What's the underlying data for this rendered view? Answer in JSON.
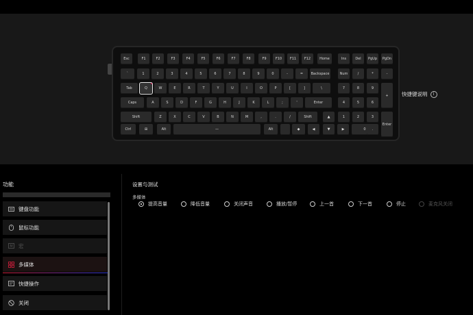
{
  "keyboard": {
    "rows": [
      [
        "Esc",
        "F1",
        "F2",
        "F3",
        "F4",
        "F5",
        "F6",
        "F7",
        "F8",
        "F9",
        "F10",
        "F11",
        "F12",
        "Home",
        "Ins",
        "Del",
        "PgUp",
        "PgDn"
      ],
      [
        "`",
        "1",
        "2",
        "3",
        "4",
        "5",
        "6",
        "7",
        "8",
        "9",
        "0",
        "-",
        "=",
        "Backspace",
        "Num",
        "/",
        "*",
        "-"
      ],
      [
        "Tab",
        "Q",
        "W",
        "E",
        "R",
        "T",
        "Y",
        "U",
        "I",
        "O",
        "P",
        "[",
        "]",
        "\\",
        "7",
        "8",
        "9",
        "+"
      ],
      [
        "Caps",
        "A",
        "S",
        "D",
        "F",
        "G",
        "H",
        "J",
        "K",
        "L",
        ";",
        "'",
        "Enter",
        "4",
        "5",
        "6"
      ],
      [
        "Shift",
        "Z",
        "X",
        "C",
        "V",
        "B",
        "N",
        "M",
        ",",
        ".",
        "/",
        "Shift",
        "▲",
        "1",
        "2",
        "3",
        "Enter"
      ],
      [
        "Ctrl",
        "⊞",
        "Alt",
        "—",
        "Alt",
        "",
        "◆",
        "◀",
        "▼",
        "▶",
        "0",
        "."
      ]
    ],
    "selected_key": "Q"
  },
  "hotkey_help": {
    "label": "快捷键说明",
    "icon": "info-icon"
  },
  "function_panel": {
    "title": "功能",
    "items": [
      {
        "label": "键盘功能",
        "icon": "keyboard-icon",
        "state": "normal"
      },
      {
        "label": "鼠标功能",
        "icon": "mouse-icon",
        "state": "normal"
      },
      {
        "label": "宏",
        "icon": "macro-icon",
        "state": "disabled"
      },
      {
        "label": "多媒体",
        "icon": "media-grid-icon",
        "state": "active"
      },
      {
        "label": "快捷操作",
        "icon": "shortcut-icon",
        "state": "normal"
      },
      {
        "label": "关闭",
        "icon": "disable-icon",
        "state": "normal"
      }
    ]
  },
  "settings": {
    "title": "设置与测试",
    "section_label": "多媒体",
    "options": [
      {
        "label": "提高音量",
        "checked": true,
        "disabled": false
      },
      {
        "label": "降低音量",
        "checked": false,
        "disabled": false
      },
      {
        "label": "关闭声音",
        "checked": false,
        "disabled": false
      },
      {
        "label": "播放/暂停",
        "checked": false,
        "disabled": false
      },
      {
        "label": "上一首",
        "checked": false,
        "disabled": false
      },
      {
        "label": "下一首",
        "checked": false,
        "disabled": false
      },
      {
        "label": "停止",
        "checked": false,
        "disabled": false
      },
      {
        "label": "麦克风关闭",
        "checked": false,
        "disabled": true
      }
    ]
  },
  "colors": {
    "accent_red": "#d0203a",
    "accent_blue": "#2a3ad8",
    "background": "#000000",
    "keyboard_area": "#181818"
  }
}
